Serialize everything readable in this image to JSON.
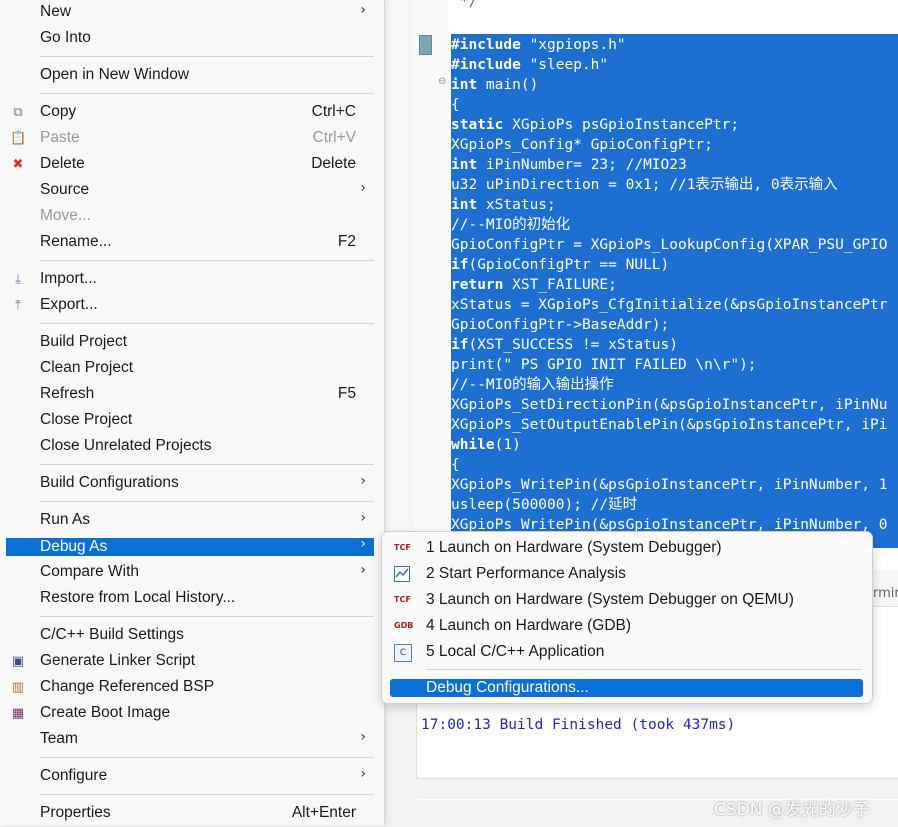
{
  "editor": {
    "comment_top": "*/",
    "lines": [
      {
        "kw": "#include",
        "rest": " \"xgpiops.h\""
      },
      {
        "kw": "#include",
        "rest": " \"sleep.h\""
      },
      {
        "kw": "int",
        "rest": " main()"
      },
      {
        "kw": "",
        "rest": "{"
      },
      {
        "kw": "static",
        "rest": " XGpioPs psGpioInstancePtr;"
      },
      {
        "kw": "",
        "rest": "XGpioPs_Config* GpioConfigPtr;"
      },
      {
        "kw": "int",
        "rest": " iPinNumber= 23; //MIO23"
      },
      {
        "kw": "",
        "rest": "u32 uPinDirection = 0x1; //1表示输出, 0表示输入"
      },
      {
        "kw": "int",
        "rest": " xStatus;"
      },
      {
        "kw": "",
        "rest": "//--MIO的初始化"
      },
      {
        "kw": "",
        "rest": "GpioConfigPtr = XGpioPs_LookupConfig(XPAR_PSU_GPIO"
      },
      {
        "kw": "if",
        "rest": "(GpioConfigPtr == NULL)"
      },
      {
        "kw": "return",
        "rest": " XST_FAILURE;"
      },
      {
        "kw": "",
        "rest": "xStatus = XGpioPs_CfgInitialize(&psGpioInstancePtr"
      },
      {
        "kw": "",
        "rest": "GpioConfigPtr->BaseAddr);"
      },
      {
        "kw": "if",
        "rest": "(XST_SUCCESS != xStatus)"
      },
      {
        "kw": "",
        "rest": "print(\" PS GPIO INIT FAILED \\n\\r\");"
      },
      {
        "kw": "",
        "rest": "//--MIO的输入输出操作"
      },
      {
        "kw": "",
        "rest": "XGpioPs_SetDirectionPin(&psGpioInstancePtr, iPinNu"
      },
      {
        "kw": "",
        "rest": "XGpioPs_SetOutputEnablePin(&psGpioInstancePtr, iPi"
      },
      {
        "kw": "while",
        "rest": "(1)"
      },
      {
        "kw": "",
        "rest": "{"
      },
      {
        "kw": "",
        "rest": "XGpioPs_WritePin(&psGpioInstancePtr, iPinNumber, 1"
      },
      {
        "kw": "",
        "rest": "usleep(500000); //延时"
      },
      {
        "kw": "",
        "rest": "XGpioPs_WritePin(&psGpioInstancePtr, iPinNumber, 0"
      }
    ]
  },
  "console": {
    "tab_fragment": "rmin",
    "line": "17:00:13 Build Finished (took 437ms)"
  },
  "watermark": "CSDN @发光的沙子",
  "context_menu": {
    "items": [
      {
        "label": "New",
        "shortcut": "",
        "submenu": true,
        "icon": ""
      },
      {
        "label": "Go Into",
        "shortcut": "",
        "submenu": false,
        "icon": ""
      },
      {
        "label": "Open in New Window",
        "shortcut": "",
        "submenu": false,
        "icon": ""
      },
      {
        "label": "Copy",
        "shortcut": "Ctrl+C",
        "submenu": false,
        "icon": "copy-icon"
      },
      {
        "label": "Paste",
        "shortcut": "Ctrl+V",
        "submenu": false,
        "icon": "paste-icon",
        "disabled": true
      },
      {
        "label": "Delete",
        "shortcut": "Delete",
        "submenu": false,
        "icon": "delete-icon"
      },
      {
        "label": "Source",
        "shortcut": "",
        "submenu": true,
        "icon": ""
      },
      {
        "label": "Move...",
        "shortcut": "",
        "submenu": false,
        "icon": "",
        "disabled": true
      },
      {
        "label": "Rename...",
        "shortcut": "F2",
        "submenu": false,
        "icon": ""
      },
      {
        "label": "Import...",
        "shortcut": "",
        "submenu": false,
        "icon": "import-icon"
      },
      {
        "label": "Export...",
        "shortcut": "",
        "submenu": false,
        "icon": "export-icon"
      },
      {
        "label": "Build Project",
        "shortcut": "",
        "submenu": false,
        "icon": ""
      },
      {
        "label": "Clean Project",
        "shortcut": "",
        "submenu": false,
        "icon": ""
      },
      {
        "label": "Refresh",
        "shortcut": "F5",
        "submenu": false,
        "icon": ""
      },
      {
        "label": "Close Project",
        "shortcut": "",
        "submenu": false,
        "icon": ""
      },
      {
        "label": "Close Unrelated Projects",
        "shortcut": "",
        "submenu": false,
        "icon": ""
      },
      {
        "label": "Build Configurations",
        "shortcut": "",
        "submenu": true,
        "icon": ""
      },
      {
        "label": "Run As",
        "shortcut": "",
        "submenu": true,
        "icon": ""
      },
      {
        "label": "Debug As",
        "shortcut": "",
        "submenu": true,
        "icon": "",
        "active": true
      },
      {
        "label": "Compare With",
        "shortcut": "",
        "submenu": true,
        "icon": ""
      },
      {
        "label": "Restore from Local History...",
        "shortcut": "",
        "submenu": false,
        "icon": ""
      },
      {
        "label": "C/C++ Build Settings",
        "shortcut": "",
        "submenu": false,
        "icon": ""
      },
      {
        "label": "Generate Linker Script",
        "shortcut": "",
        "submenu": false,
        "icon": "linker-script-icon"
      },
      {
        "label": "Change Referenced BSP",
        "shortcut": "",
        "submenu": false,
        "icon": "bsp-icon"
      },
      {
        "label": "Create Boot Image",
        "shortcut": "",
        "submenu": false,
        "icon": "boot-image-icon"
      },
      {
        "label": "Team",
        "shortcut": "",
        "submenu": true,
        "icon": ""
      },
      {
        "label": "Configure",
        "shortcut": "",
        "submenu": true,
        "icon": ""
      },
      {
        "label": "Properties",
        "shortcut": "Alt+Enter",
        "submenu": false,
        "icon": ""
      }
    ]
  },
  "debug_submenu": {
    "items": [
      {
        "label": "1 Launch on Hardware (System Debugger)",
        "icon": "tcf-icon",
        "icon_text": "TCF"
      },
      {
        "label": "2 Start Performance Analysis",
        "icon": "performance-chart-icon",
        "icon_text": ""
      },
      {
        "label": "3 Launch on Hardware (System Debugger on QEMU)",
        "icon": "tcf-icon",
        "icon_text": "TCF"
      },
      {
        "label": "4 Launch on Hardware (GDB)",
        "icon": "gdb-icon",
        "icon_text": "GDB"
      },
      {
        "label": "5 Local C/C++ Application",
        "icon": "c-app-icon",
        "icon_text": "C"
      },
      {
        "label": "Debug Configurations...",
        "icon": "",
        "icon_text": "",
        "active": true
      }
    ]
  },
  "colors": {
    "selection": "#1e6fd2",
    "menu_highlight": "#0b6fd6",
    "console_text": "#2424c8",
    "delete_icon": "#d9342b"
  }
}
